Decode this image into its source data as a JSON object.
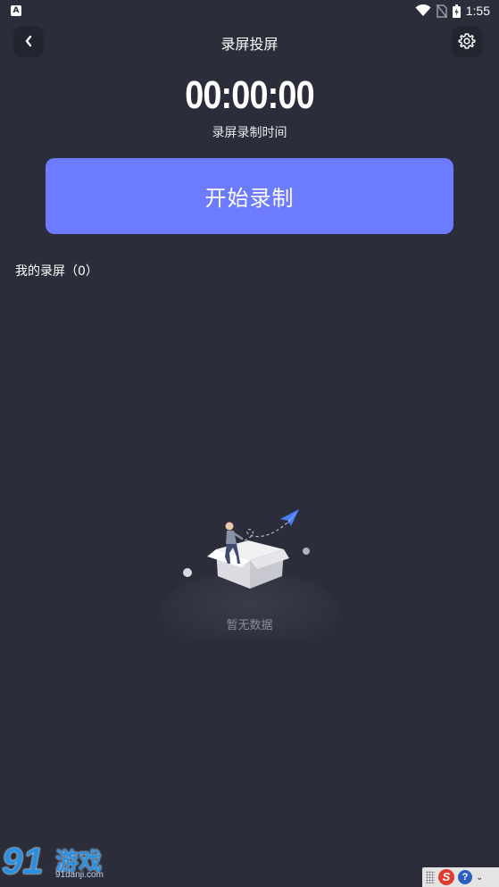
{
  "status_bar": {
    "app_icon_letter": "A",
    "time": "1:55"
  },
  "header": {
    "title": "录屏投屏"
  },
  "timer": {
    "value": "00:00:00",
    "label": "录屏录制时间"
  },
  "actions": {
    "start_label": "开始录制"
  },
  "recordings": {
    "section_label": "我的录屏（0）",
    "empty_text": "暂无数据"
  },
  "watermark": {
    "number": "91",
    "text": "游戏",
    "url": "91danji.com"
  },
  "ime": {
    "logo": "S",
    "help": "?",
    "arrow": "⌄"
  },
  "colors": {
    "background": "#2b2d3a",
    "accent": "#6c7bff"
  },
  "icons": {
    "back": "chevron-left-icon",
    "settings": "gear-icon",
    "wifi": "wifi-icon",
    "sim": "no-sim-icon",
    "battery": "battery-icon"
  }
}
